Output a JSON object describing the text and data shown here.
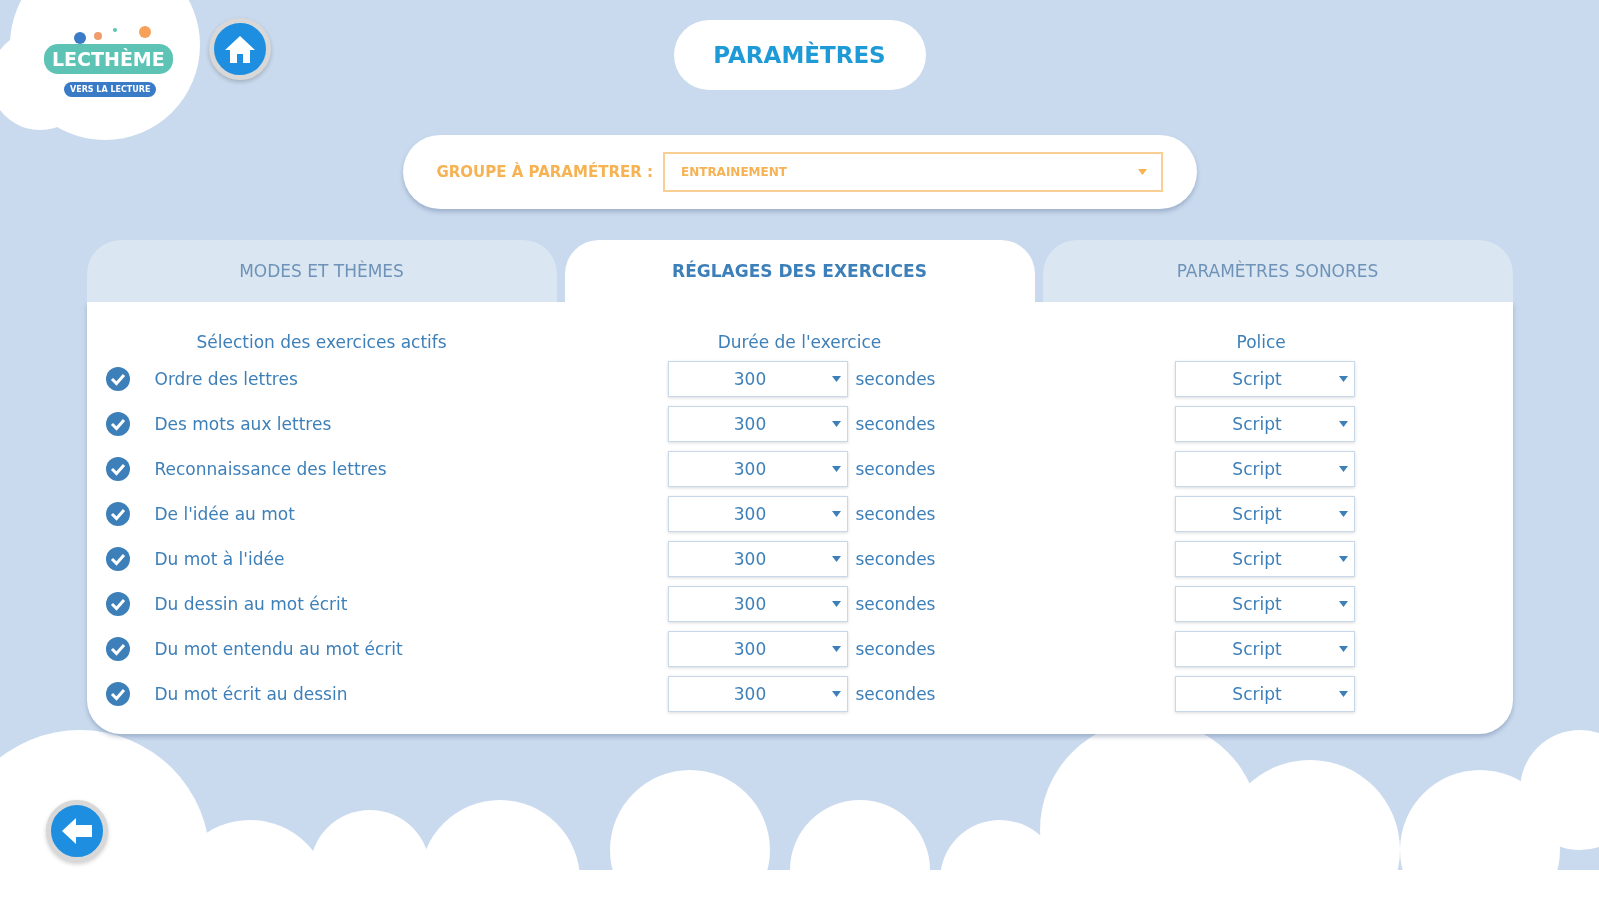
{
  "logo": {
    "title": "LECTHÈME",
    "subtitle": "VERS LA LECTURE"
  },
  "title": "PARAMÈTRES",
  "group": {
    "label": "GROUPE À PARAMÉTRER :",
    "value": "ENTRAINEMENT"
  },
  "tabs": [
    {
      "label": "MODES ET THÈMES",
      "selected": false
    },
    {
      "label": "RÉGLAGES DES EXERCICES",
      "selected": true
    },
    {
      "label": "PARAMÈTRES SONORES",
      "selected": false
    }
  ],
  "columns": [
    "Sélection des exercices actifs",
    "Durée de l'exercice",
    "Police"
  ],
  "exercises": [
    {
      "name": "Ordre des lettres",
      "checked": true,
      "duration": "300",
      "unit": "secondes",
      "font": "Script"
    },
    {
      "name": "Des mots aux lettres",
      "checked": true,
      "duration": "300",
      "unit": "secondes",
      "font": "Script"
    },
    {
      "name": "Reconnaissance des lettres",
      "checked": true,
      "duration": "300",
      "unit": "secondes",
      "font": "Script"
    },
    {
      "name": "De l'idée au mot",
      "checked": true,
      "duration": "300",
      "unit": "secondes",
      "font": "Script"
    },
    {
      "name": "Du mot à l'idée",
      "checked": true,
      "duration": "300",
      "unit": "secondes",
      "font": "Script"
    },
    {
      "name": "Du dessin au mot écrit",
      "checked": true,
      "duration": "300",
      "unit": "secondes",
      "font": "Script"
    },
    {
      "name": "Du mot entendu au mot écrit",
      "checked": true,
      "duration": "300",
      "unit": "secondes",
      "font": "Script"
    },
    {
      "name": "Du mot écrit au dessin",
      "checked": true,
      "duration": "300",
      "unit": "secondes",
      "font": "Script"
    }
  ]
}
